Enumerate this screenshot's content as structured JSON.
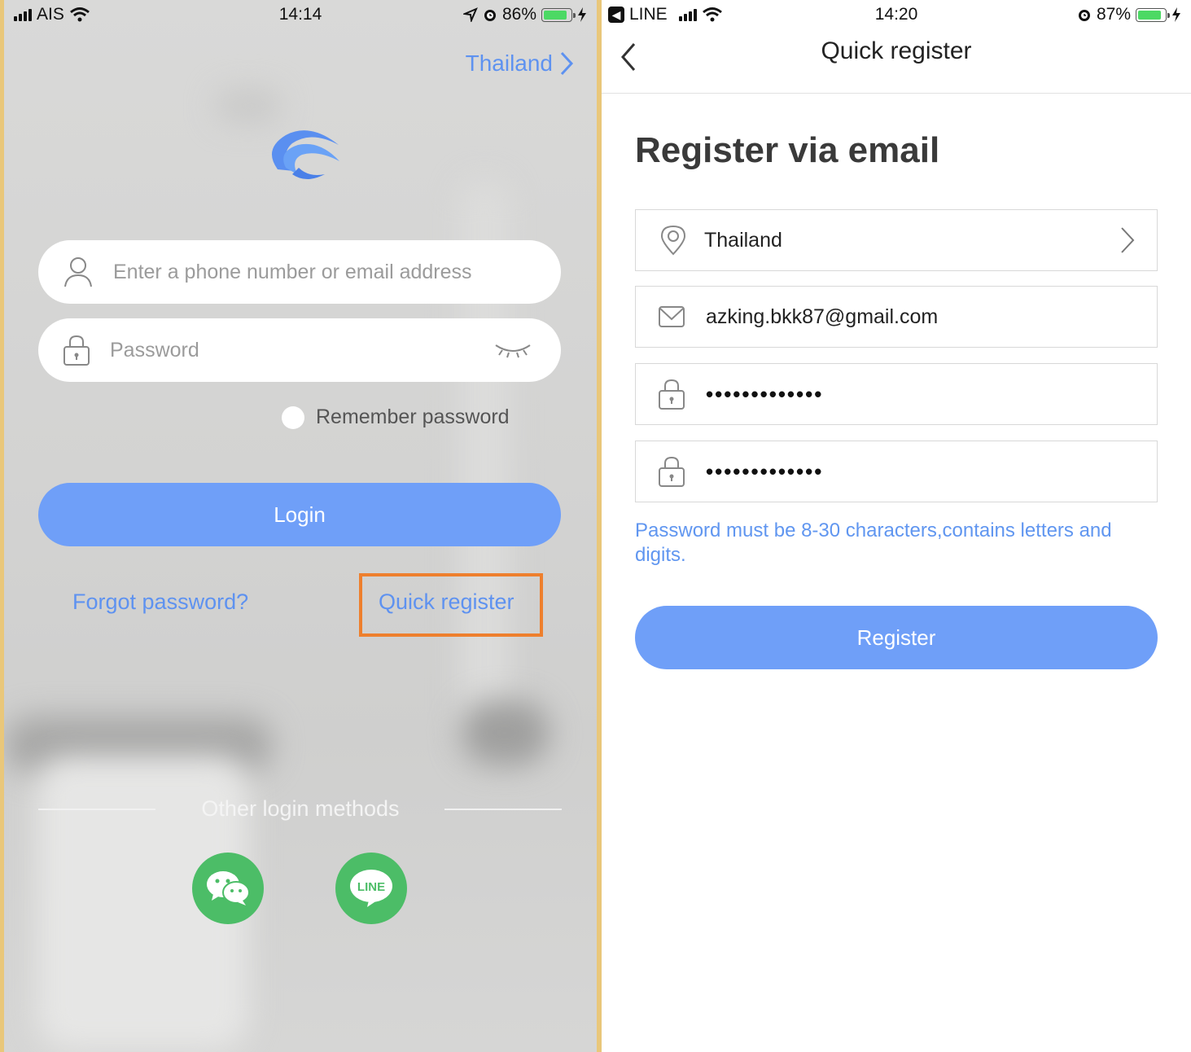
{
  "left": {
    "status": {
      "carrier": "AIS",
      "time": "14:14",
      "battery": "86%",
      "battery_level": 0.86
    },
    "country": "Thailand",
    "login_input": {
      "placeholder": "Enter a phone number or email address"
    },
    "password_input": {
      "placeholder": "Password"
    },
    "remember": "Remember password",
    "login_button": "Login",
    "forgot": "Forgot password?",
    "quick_register": "Quick register",
    "other_methods": "Other login methods",
    "social_line_label": "LINE",
    "colors": {
      "accent": "#6f9ff8",
      "link": "#5e92f0",
      "highlight": "#ee7f2d",
      "social": "#4cbd67"
    }
  },
  "right": {
    "status": {
      "back_app": "LINE",
      "time": "14:20",
      "battery": "87%",
      "battery_level": 0.87
    },
    "nav_title": "Quick register",
    "heading": "Register via email",
    "country_field": "Thailand",
    "email_field": "azking.bkk87@gmail.com",
    "password_field": "•••••••••••••",
    "confirm_field": "•••••••••••••",
    "hint": "Password must be 8-30 characters,contains letters and digits.",
    "register_button": "Register"
  }
}
